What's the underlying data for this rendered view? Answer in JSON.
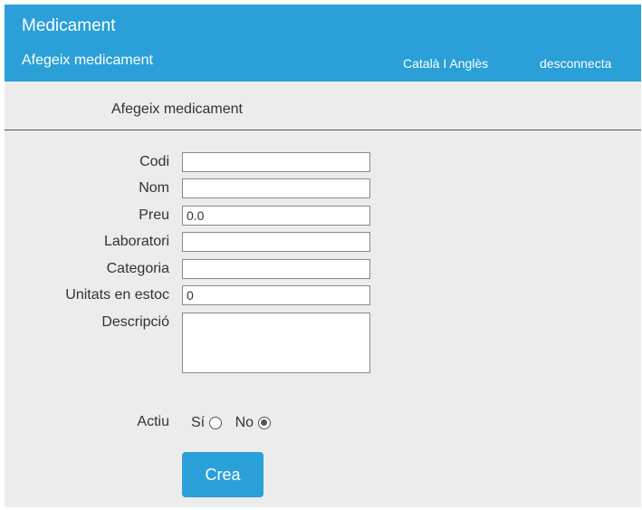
{
  "header": {
    "app_title": "Medicament",
    "subtitle": "Afegeix medicament",
    "lang_catalan": "Català",
    "lang_separator": "I",
    "lang_english": "Anglès",
    "logout": "desconnecta"
  },
  "page_title": "Afegeix medicament",
  "form": {
    "codi": {
      "label": "Codi",
      "value": ""
    },
    "nom": {
      "label": "Nom",
      "value": ""
    },
    "preu": {
      "label": "Preu",
      "value": "0.0"
    },
    "laboratori": {
      "label": "Laboratori",
      "value": ""
    },
    "categoria": {
      "label": "Categoria",
      "value": ""
    },
    "unitats": {
      "label": "Unitats en estoc",
      "value": "0"
    },
    "descripcio": {
      "label": "Descripció",
      "value": ""
    },
    "actiu": {
      "label": "Actiu",
      "yes": "Sí",
      "no": "No",
      "selected": "No"
    }
  },
  "submit_label": "Crea",
  "colors": {
    "accent": "#2a9fd8",
    "background": "#ececec"
  }
}
